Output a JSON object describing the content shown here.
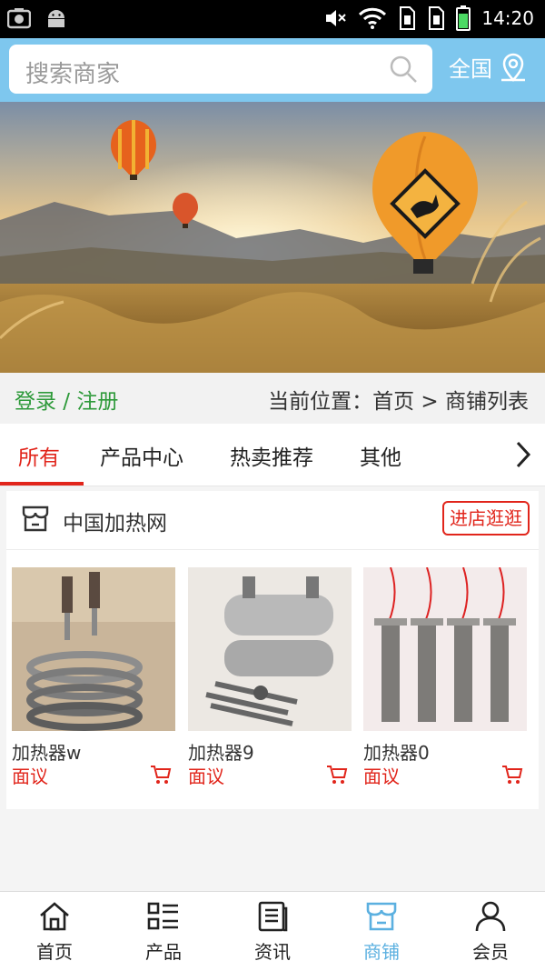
{
  "status_bar": {
    "time": "14:20"
  },
  "header": {
    "search_placeholder": "搜索商家",
    "region_label": "全国",
    "accent_color": "#7ec7ee"
  },
  "info_bar": {
    "login_label": "登录 / 注册",
    "breadcrumb": "当前位置：首页 > 商铺列表"
  },
  "tabs": [
    {
      "label": "所有",
      "active": true
    },
    {
      "label": "产品中心"
    },
    {
      "label": "热卖推荐"
    },
    {
      "label": "其他"
    }
  ],
  "shop": {
    "name": "中国加热网",
    "visit_button": "进店逛逛",
    "products": [
      {
        "name": "加热器w",
        "price": "面议"
      },
      {
        "name": "加热器9",
        "price": "面议"
      },
      {
        "name": "加热器0",
        "price": "面议"
      }
    ]
  },
  "bottom_nav": [
    {
      "label": "首页",
      "icon": "home-icon"
    },
    {
      "label": "产品",
      "icon": "list-icon"
    },
    {
      "label": "资讯",
      "icon": "news-icon"
    },
    {
      "label": "商铺",
      "icon": "store-icon",
      "active": true
    },
    {
      "label": "会员",
      "icon": "user-icon"
    }
  ]
}
